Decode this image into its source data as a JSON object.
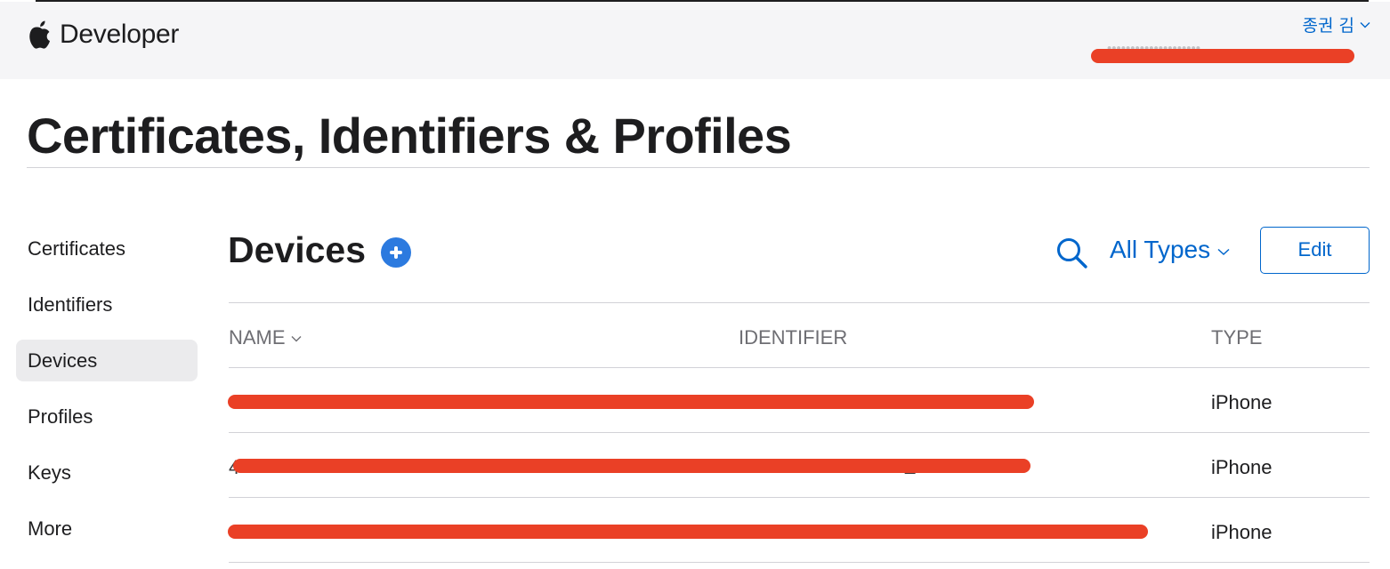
{
  "nav": {
    "brand": "Developer",
    "account_name": "종권 김",
    "team_name": "••••••••••••••••••••"
  },
  "page": {
    "title": "Certificates, Identifiers & Profiles"
  },
  "sidebar": {
    "items": [
      {
        "label": "Certificates"
      },
      {
        "label": "Identifiers"
      },
      {
        "label": "Devices",
        "active": true
      },
      {
        "label": "Profiles"
      },
      {
        "label": "Keys"
      },
      {
        "label": "More"
      }
    ]
  },
  "devices": {
    "title": "Devices",
    "filter_label": "All Types",
    "edit_label": "Edit",
    "columns": {
      "name": "NAME",
      "identifier": "IDENTIFIER",
      "type": "TYPE"
    },
    "rows": [
      {
        "name": "•••••",
        "identifier": "••••••••••••••••••••••••E",
        "type": "iPhone"
      },
      {
        "name": "4•••••",
        "identifier": "••••••••••••••••••••••••E",
        "type": "iPhone"
      },
      {
        "name": "•••••••••••••••",
        "identifier": "••••••••••••••••••••••••••••••.",
        "type": "iPhone"
      }
    ]
  },
  "colors": {
    "accent": "#0066cc",
    "add_button": "#2c7adf",
    "redaction": "#ea4026",
    "nav_background": "#f5f5f7",
    "active_item_background": "#ebebed"
  },
  "icons": {
    "brand": "apple-logo-icon",
    "account_menu": "chevron-down-icon",
    "add": "plus-circle-icon",
    "search": "search-icon",
    "filter_menu": "chevron-down-icon",
    "sort": "chevron-down-icon"
  }
}
